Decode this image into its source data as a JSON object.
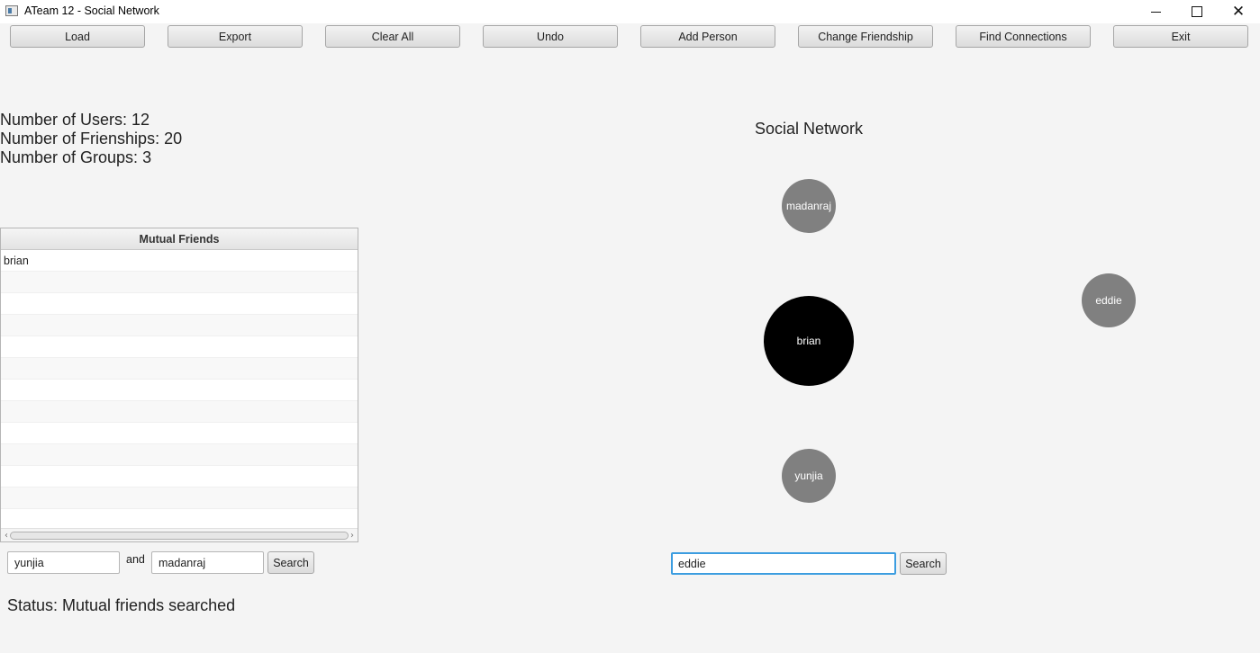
{
  "window": {
    "title": "ATeam 12 - Social Network",
    "controls": {
      "minimize": "minimize",
      "maximize": "maximize",
      "close": "✕"
    }
  },
  "toolbar": {
    "load": "Load",
    "export": "Export",
    "clear_all": "Clear All",
    "undo": "Undo",
    "add_person": "Add Person",
    "change_friendship": "Change Friendship",
    "find_connections": "Find Connections",
    "exit": "Exit"
  },
  "stats": {
    "users": "Number of Users: 12",
    "friendships": "Number of Frienships: 20",
    "groups": "Number of Groups: 3"
  },
  "mutual_friends": {
    "header": "Mutual Friends",
    "rows": [
      "brian",
      "",
      "",
      "",
      "",
      "",
      "",
      "",
      "",
      "",
      "",
      "",
      ""
    ],
    "user1": "yunjia",
    "and_label": "and",
    "user2": "madanraj",
    "search_label": "Search"
  },
  "status": "Status: Mutual friends searched",
  "graph": {
    "title": "Social Network",
    "center_node": "brian",
    "nodes": {
      "top": "madanraj",
      "right": "eddie",
      "bottom": "yunjia"
    },
    "node_colors": {
      "center": "#000000",
      "friend": "#808080"
    },
    "search_value": "eddie",
    "search_label": "Search"
  }
}
